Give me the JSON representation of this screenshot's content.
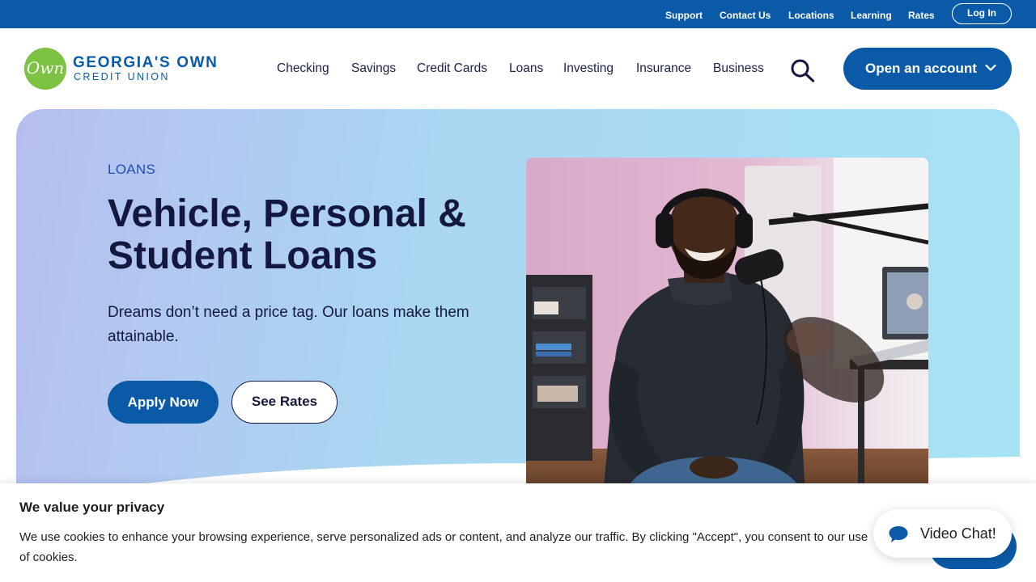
{
  "utility_nav": {
    "support": "Support",
    "contact_us": "Contact Us",
    "locations": "Locations",
    "learning": "Learning",
    "rates": "Rates",
    "login": "Log In"
  },
  "brand": {
    "logo_mark": "Own",
    "name_line1": "GEORGIA'S OWN",
    "name_line2": "CREDIT UNION"
  },
  "main_nav": {
    "items": [
      "Checking",
      "Savings",
      "Credit Cards",
      "Loans",
      "Investing",
      "Insurance",
      "Business"
    ],
    "search_icon": "search-icon",
    "open_account": "Open an account"
  },
  "hero": {
    "eyebrow": "LOANS",
    "title": "Vehicle, Personal & Student Loans",
    "subtitle": "Dreams don’t need a price tag. Our loans make them attainable.",
    "apply_label": "Apply Now",
    "rates_label": "See Rates"
  },
  "cookie_banner": {
    "title": "We value your privacy",
    "text": "We use cookies to enhance your browsing experience, serve personalized ads or content, and analyze our traffic. By clicking \"Accept\", you consent to our use of cookies."
  },
  "chat": {
    "label": "Video Chat!",
    "icon": "chat-bubble-icon"
  },
  "colors": {
    "brand_blue": "#0a5aa8",
    "logo_green": "#7dc242",
    "heading_navy": "#14183f"
  }
}
